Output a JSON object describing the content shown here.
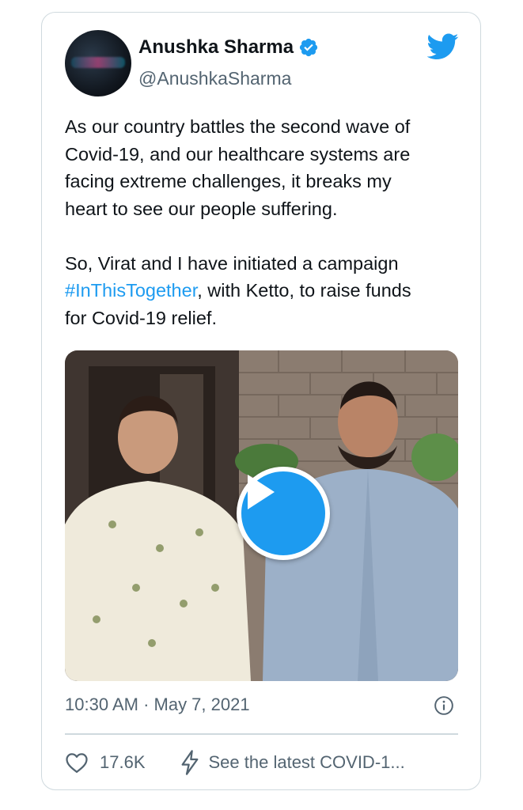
{
  "author": {
    "name": "Anushka Sharma",
    "handle": "@AnushkaSharma",
    "verified": true,
    "avatar_icon": "profile-avatar"
  },
  "tweet": {
    "paragraph1": "As our country battles the second wave of\nCovid-19, and our healthcare systems are\nfacing extreme challenges, it breaks my\nheart to see our people suffering.",
    "paragraph2_before": "So, Virat and I have initiated a campaign\n",
    "hashtag": "#InThisTogether",
    "paragraph2_after": ", with Ketto, to raise funds\nfor Covid-19 relief."
  },
  "media": {
    "type": "video",
    "play_icon": "play-icon"
  },
  "meta": {
    "timestamp": "10:30 AM · May 7, 2021"
  },
  "actions": {
    "like_count": "17.6K",
    "covid_link": "See the latest COVID-1..."
  },
  "colors": {
    "accent": "#1d9bf0",
    "secondary_text": "#536471",
    "border": "#cfd9de"
  }
}
